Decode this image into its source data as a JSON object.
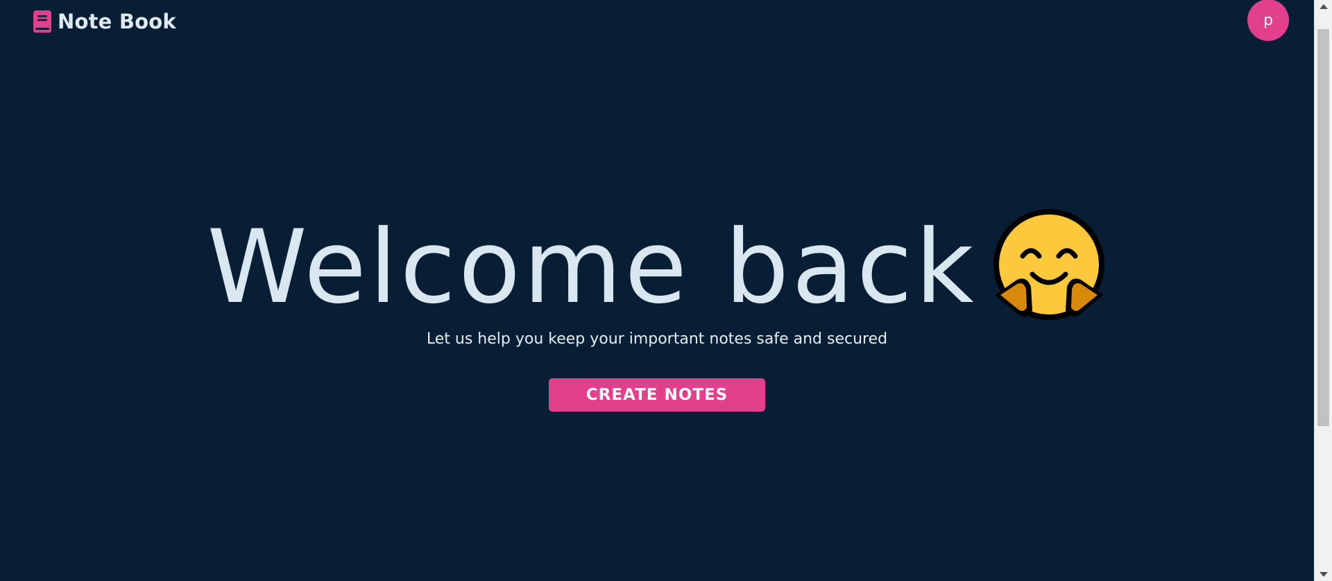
{
  "header": {
    "brand_name": "Note Book",
    "brand_icon": "book-icon",
    "avatar_initial": "p"
  },
  "hero": {
    "headline": "Welcome back",
    "emoji": "hugging-face-emoji",
    "tagline": "Let us help you keep your important notes safe and secured",
    "cta_label": "CREATE NOTES"
  },
  "colors": {
    "background": "#071e35",
    "accent": "#e23f8c",
    "headline_text": "#d9e7f0",
    "body_text": "#e6eef4"
  }
}
